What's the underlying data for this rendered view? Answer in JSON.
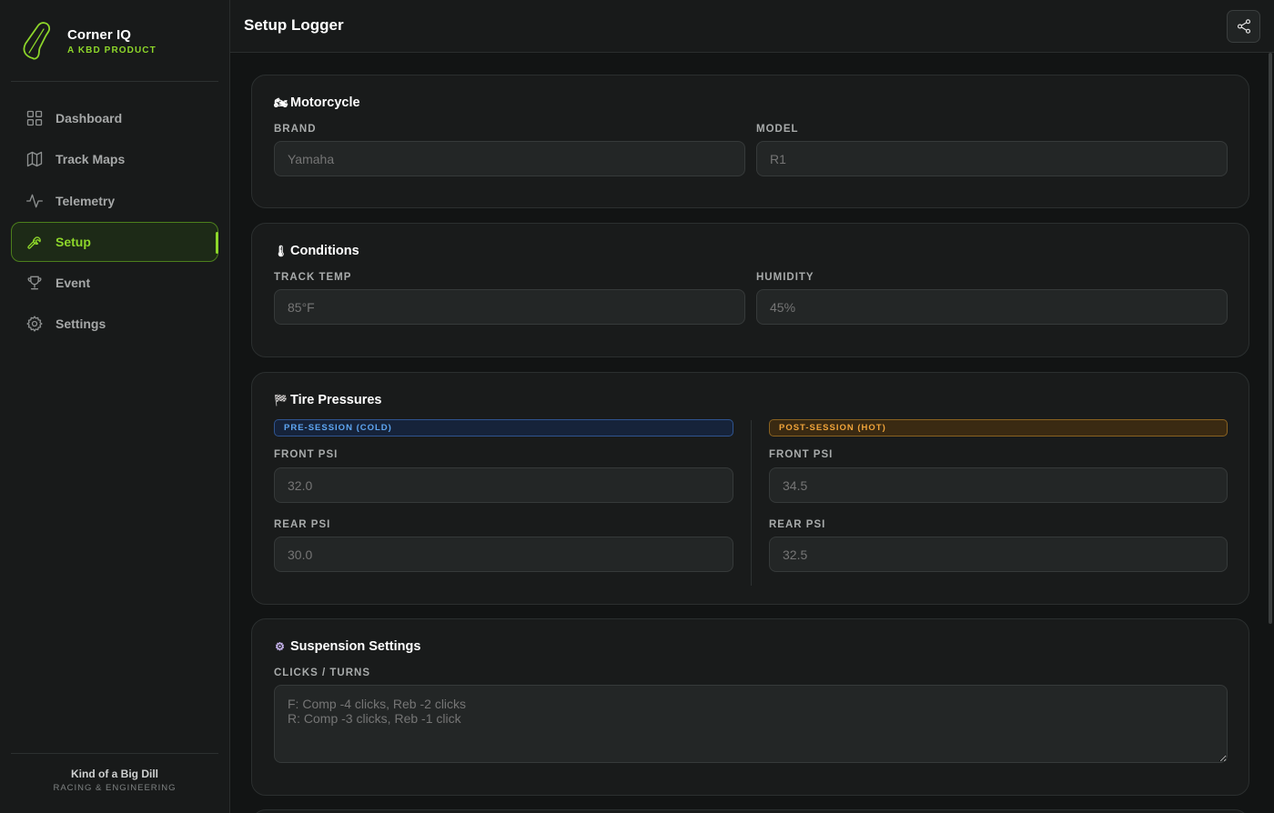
{
  "brand": {
    "name": "Corner IQ",
    "tagline": "A KBD PRODUCT"
  },
  "nav": [
    {
      "label": "Dashboard",
      "icon": "grid-icon",
      "active": false
    },
    {
      "label": "Track Maps",
      "icon": "map-icon",
      "active": false
    },
    {
      "label": "Telemetry",
      "icon": "activity-icon",
      "active": false
    },
    {
      "label": "Setup",
      "icon": "wrench-icon",
      "active": true
    },
    {
      "label": "Event",
      "icon": "trophy-icon",
      "active": false
    },
    {
      "label": "Settings",
      "icon": "gear-icon",
      "active": false
    }
  ],
  "footer": {
    "title": "Kind of a Big Dill",
    "subtitle": "RACING & ENGINEERING"
  },
  "header": {
    "title": "Setup Logger",
    "share_icon": "share-icon"
  },
  "motorcycle": {
    "title": "Motorcycle",
    "icon": "🏍",
    "brand_label": "BRAND",
    "brand_placeholder": "Yamaha",
    "model_label": "MODEL",
    "model_placeholder": "R1"
  },
  "conditions": {
    "title": "Conditions",
    "icon": "🌡",
    "track_temp_label": "TRACK TEMP",
    "track_temp_placeholder": "85°F",
    "humidity_label": "HUMIDITY",
    "humidity_placeholder": "45%"
  },
  "tires": {
    "title": "Tire Pressures",
    "icon": "🏁",
    "pre_badge": "PRE-SESSION (COLD)",
    "post_badge": "POST-SESSION (HOT)",
    "front_label": "FRONT PSI",
    "rear_label": "REAR PSI",
    "pre_front_placeholder": "32.0",
    "pre_rear_placeholder": "30.0",
    "post_front_placeholder": "34.5",
    "post_rear_placeholder": "32.5"
  },
  "suspension": {
    "title": "Suspension Settings",
    "icon": "⚙",
    "label": "CLICKS / TURNS",
    "placeholder": "F: Comp -4 clicks, Reb -2 clicks\nR: Comp -3 clicks, Reb -1 click"
  },
  "colors": {
    "accent": "#8dd62a",
    "cold": "#5ea6f2",
    "hot": "#f0a43a",
    "background": "#121414"
  }
}
